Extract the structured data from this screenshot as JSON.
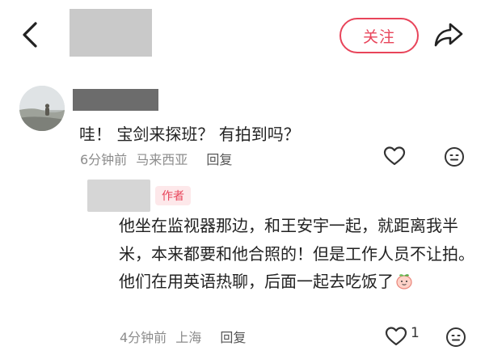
{
  "header": {
    "follow_label": "关注"
  },
  "comment": {
    "text": "哇！ 宝剑来探班？ 有拍到吗？",
    "time": "6分钟前",
    "location": "马来西亚",
    "reply_label": "回复"
  },
  "reply": {
    "author_badge": "作者",
    "text": "他坐在监视器那边，和王安宇一起，就距离我半米，本来都要和他合照的！但是工作人员不让拍。他们在用英语热聊，后面一起去吃饭了",
    "time": "4分钟前",
    "location": "上海",
    "reply_label": "回复",
    "like_count": "1"
  },
  "icons": {
    "back": "chevron-left-icon",
    "share": "share-arrow-icon",
    "like": "heart-outline-icon",
    "react": "smiley-face-icon",
    "emoji": "peach-emoji-icon"
  },
  "colors": {
    "accent": "#e8445a",
    "meta_text": "#8c8c8c",
    "badge_bg": "#fde8ea"
  }
}
